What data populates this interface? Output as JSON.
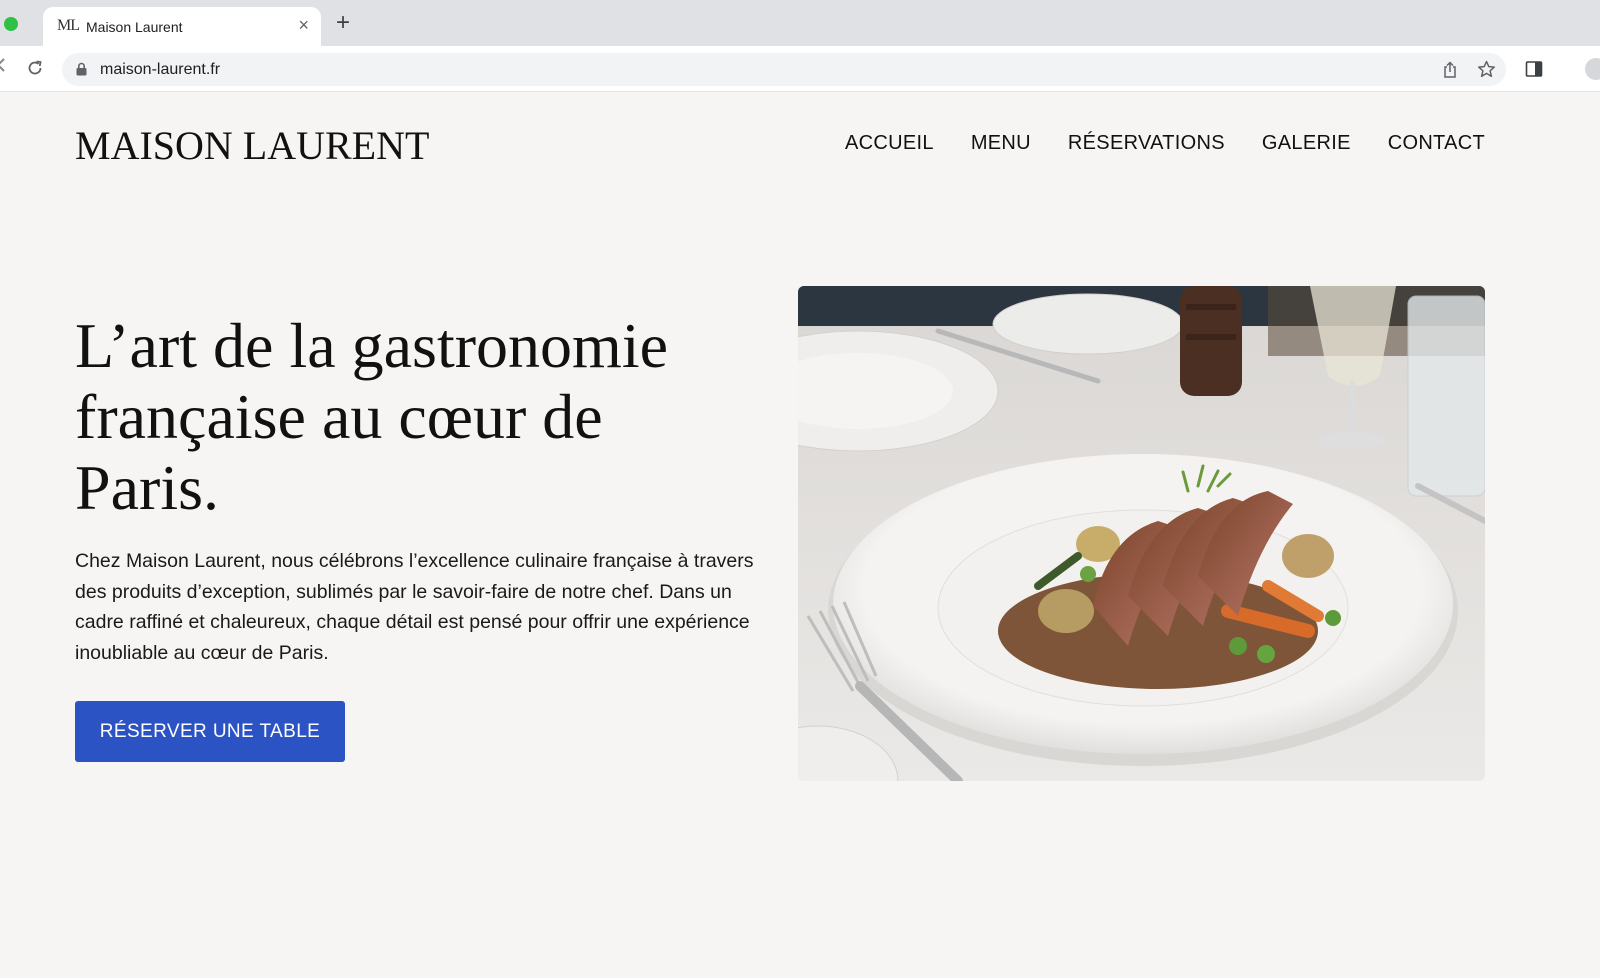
{
  "browser": {
    "tab": {
      "favicon_text": "ML",
      "title": "Maison Laurent",
      "close_glyph": "×"
    },
    "new_tab_glyph": "+",
    "address": {
      "url": "maison-laurent.fr"
    },
    "icons": [
      "back-arrow-icon",
      "reload-icon",
      "lock-icon",
      "share-icon",
      "star-icon",
      "side-panel-icon",
      "profile-icon"
    ]
  },
  "site": {
    "logo": "MAISON LAURENT",
    "nav": [
      "ACCUEIL",
      "MENU",
      "RÉSERVATIONS",
      "GALERIE",
      "CONTACT"
    ],
    "hero": {
      "title_lines": [
        "L’art de la gastronomie",
        "française au cœur de",
        "Paris."
      ],
      "body": "Chez Maison Laurent, nous célébrons l’excellence culinaire française à travers des produits d’exception, sublimés par le savoir-faire de notre chef. Dans un cadre raffiné et chaleureux, chaque détail est pensé pour offrir une expérience inoubliable au cœur de Paris.",
      "cta_label": "RÉSERVER UNE TABLE",
      "image_subject": "plated duck breast with vegetables on a set restaurant table"
    }
  },
  "colors": {
    "page_background": "#f6f5f3",
    "cta_background": "#2b53c4",
    "cta_text": "#ffffff",
    "text": "#111111",
    "tabbar": "#dfe1e5"
  }
}
